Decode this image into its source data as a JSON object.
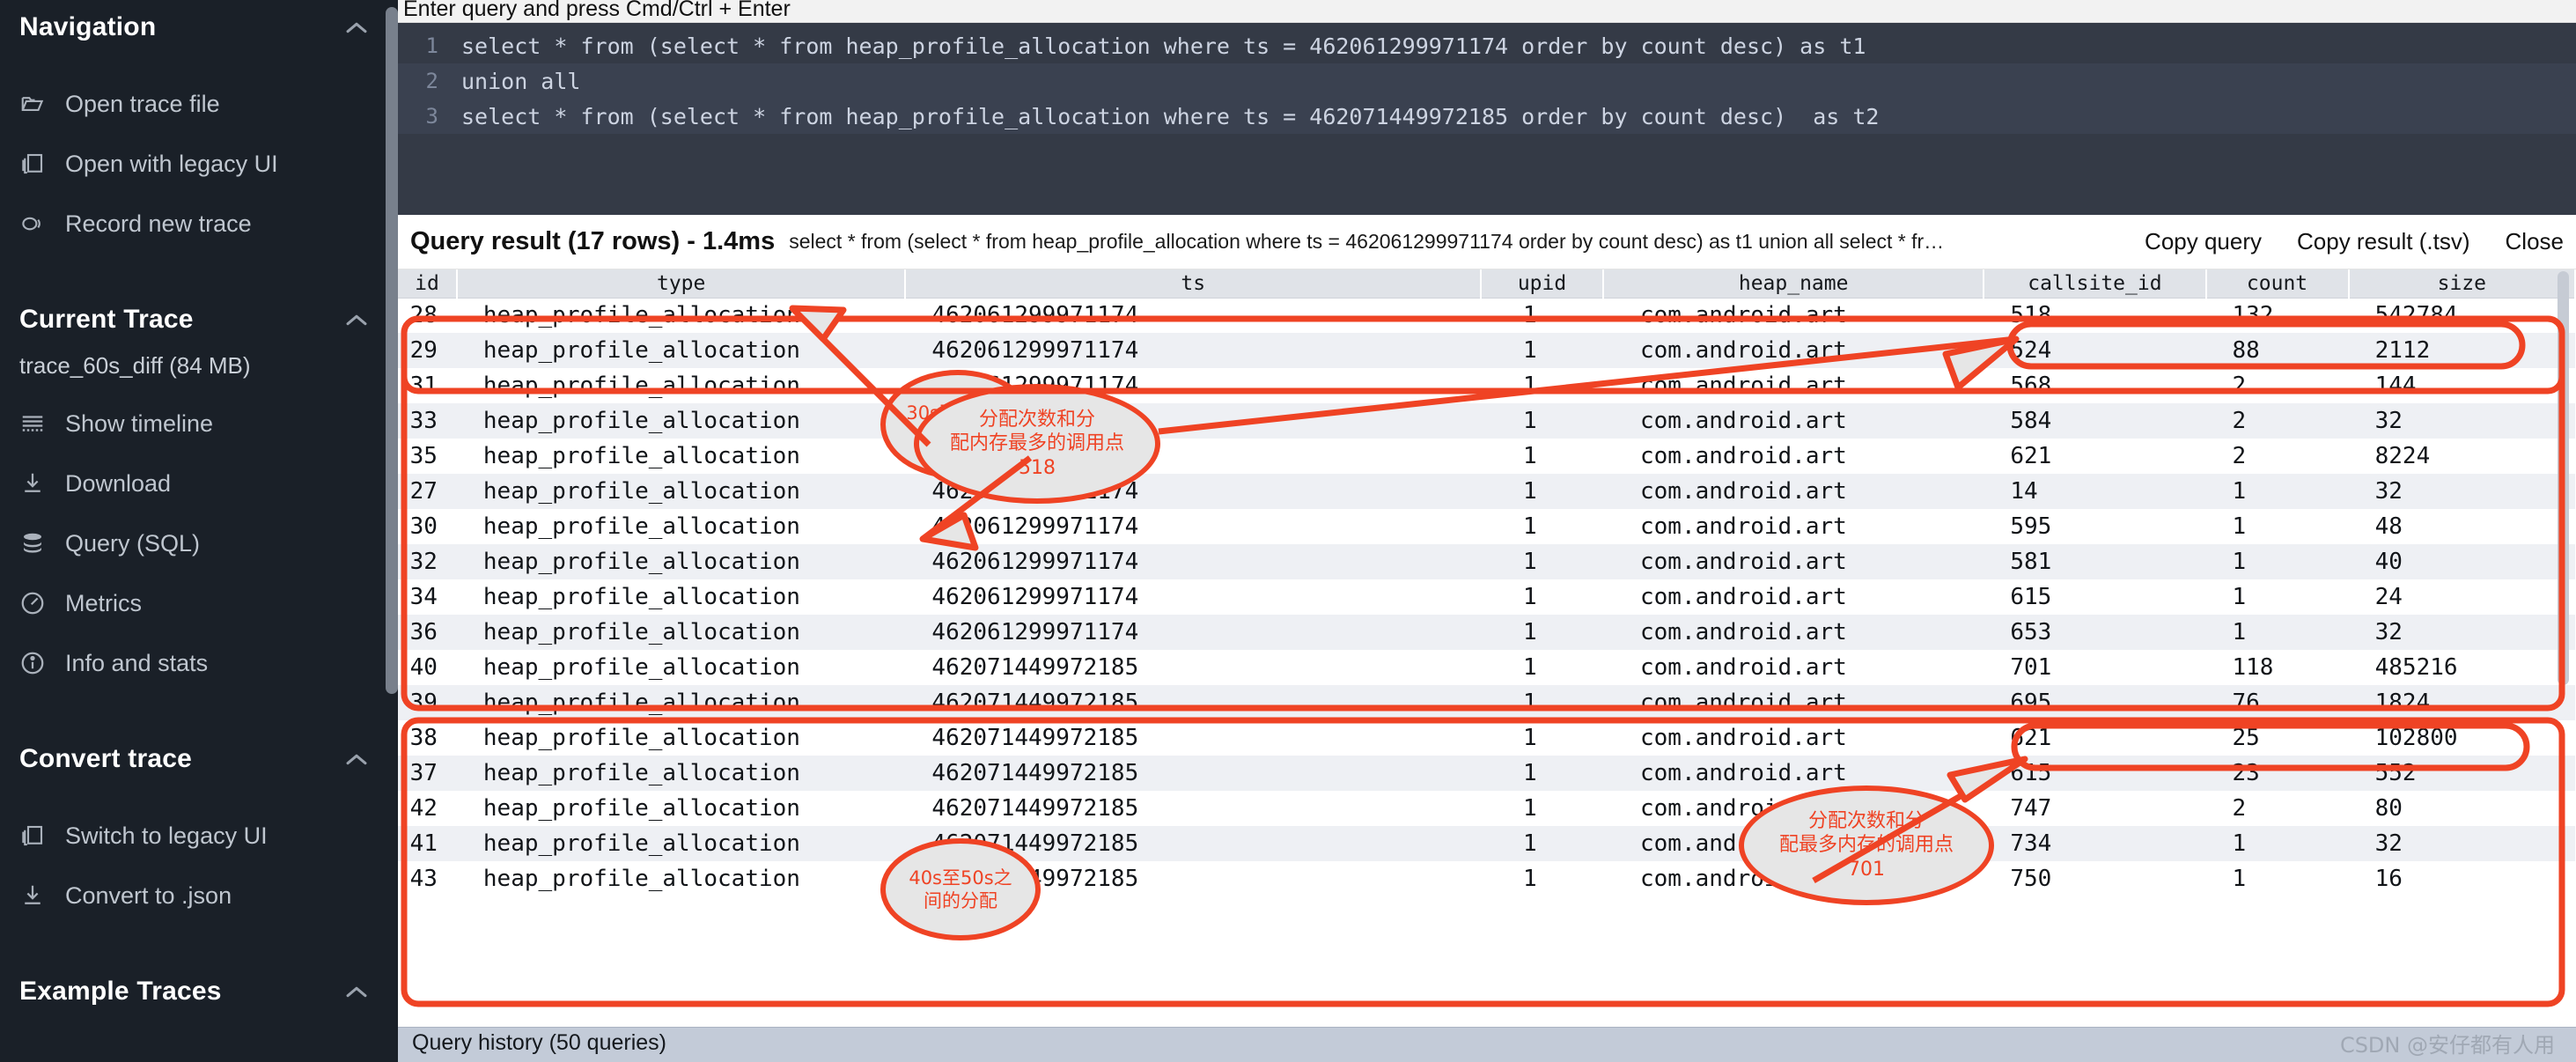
{
  "sidebar": {
    "sections": [
      {
        "title": "Navigation",
        "items": [
          {
            "label": "Open trace file",
            "icon": "folder-open-icon"
          },
          {
            "label": "Open with legacy UI",
            "icon": "window-copy-icon"
          },
          {
            "label": "Record new trace",
            "icon": "record-icon"
          }
        ]
      },
      {
        "title": "Current Trace",
        "trace_name": "trace_60s_diff (84 MB)",
        "items": [
          {
            "label": "Show timeline",
            "icon": "timeline-icon"
          },
          {
            "label": "Download",
            "icon": "download-icon"
          },
          {
            "label": "Query (SQL)",
            "icon": "database-icon"
          },
          {
            "label": "Metrics",
            "icon": "gauge-icon"
          },
          {
            "label": "Info and stats",
            "icon": "info-icon"
          }
        ]
      },
      {
        "title": "Convert trace",
        "items": [
          {
            "label": "Switch to legacy UI",
            "icon": "window-copy-icon"
          },
          {
            "label": "Convert to .json",
            "icon": "download-icon"
          }
        ]
      },
      {
        "title": "Example Traces",
        "items": []
      }
    ]
  },
  "omnibox": {
    "hint": "Enter query and press Cmd/Ctrl + Enter"
  },
  "editor": {
    "lines": [
      {
        "number": "1",
        "text": "select * from (select * from heap_profile_allocation where ts = 462061299971174 order by count desc) as t1"
      },
      {
        "number": "2",
        "text": "union all"
      },
      {
        "number": "3",
        "text": "select * from (select * from heap_profile_allocation where ts = 462071449972185 order by count desc)  as t2"
      }
    ]
  },
  "result_header": {
    "title": "Query result (17 rows) - 1.4ms",
    "query_summary": "select * from (select * from heap_profile_allocation where ts = 462061299971174 order by count desc) as t1 union all select * fr…",
    "copy_query_label": "Copy query",
    "copy_result_label": "Copy result (.tsv)",
    "close_label": "Close"
  },
  "table": {
    "columns": [
      "id",
      "type",
      "ts",
      "upid",
      "heap_name",
      "callsite_id",
      "count",
      "size"
    ],
    "rows": [
      {
        "id": "28",
        "type": "heap_profile_allocation",
        "ts": "462061299971174",
        "upid": "1",
        "heap_name": "com.android.art",
        "callsite_id": "518",
        "count": "132",
        "size": "542784"
      },
      {
        "id": "29",
        "type": "heap_profile_allocation",
        "ts": "462061299971174",
        "upid": "1",
        "heap_name": "com.android.art",
        "callsite_id": "524",
        "count": "88",
        "size": "2112"
      },
      {
        "id": "31",
        "type": "heap_profile_allocation",
        "ts": "462061299971174",
        "upid": "1",
        "heap_name": "com.android.art",
        "callsite_id": "568",
        "count": "2",
        "size": "144"
      },
      {
        "id": "33",
        "type": "heap_profile_allocation",
        "ts": "462061299971174",
        "upid": "1",
        "heap_name": "com.android.art",
        "callsite_id": "584",
        "count": "2",
        "size": "32"
      },
      {
        "id": "35",
        "type": "heap_profile_allocation",
        "ts": "462061299971174",
        "upid": "1",
        "heap_name": "com.android.art",
        "callsite_id": "621",
        "count": "2",
        "size": "8224"
      },
      {
        "id": "27",
        "type": "heap_profile_allocation",
        "ts": "462061299971174",
        "upid": "1",
        "heap_name": "com.android.art",
        "callsite_id": "14",
        "count": "1",
        "size": "32"
      },
      {
        "id": "30",
        "type": "heap_profile_allocation",
        "ts": "462061299971174",
        "upid": "1",
        "heap_name": "com.android.art",
        "callsite_id": "595",
        "count": "1",
        "size": "48"
      },
      {
        "id": "32",
        "type": "heap_profile_allocation",
        "ts": "462061299971174",
        "upid": "1",
        "heap_name": "com.android.art",
        "callsite_id": "581",
        "count": "1",
        "size": "40"
      },
      {
        "id": "34",
        "type": "heap_profile_allocation",
        "ts": "462061299971174",
        "upid": "1",
        "heap_name": "com.android.art",
        "callsite_id": "615",
        "count": "1",
        "size": "24"
      },
      {
        "id": "36",
        "type": "heap_profile_allocation",
        "ts": "462061299971174",
        "upid": "1",
        "heap_name": "com.android.art",
        "callsite_id": "653",
        "count": "1",
        "size": "32"
      },
      {
        "id": "40",
        "type": "heap_profile_allocation",
        "ts": "462071449972185",
        "upid": "1",
        "heap_name": "com.android.art",
        "callsite_id": "701",
        "count": "118",
        "size": "485216"
      },
      {
        "id": "39",
        "type": "heap_profile_allocation",
        "ts": "462071449972185",
        "upid": "1",
        "heap_name": "com.android.art",
        "callsite_id": "695",
        "count": "76",
        "size": "1824"
      },
      {
        "id": "38",
        "type": "heap_profile_allocation",
        "ts": "462071449972185",
        "upid": "1",
        "heap_name": "com.android.art",
        "callsite_id": "621",
        "count": "25",
        "size": "102800"
      },
      {
        "id": "37",
        "type": "heap_profile_allocation",
        "ts": "462071449972185",
        "upid": "1",
        "heap_name": "com.android.art",
        "callsite_id": "615",
        "count": "23",
        "size": "552"
      },
      {
        "id": "42",
        "type": "heap_profile_allocation",
        "ts": "462071449972185",
        "upid": "1",
        "heap_name": "com.android.art",
        "callsite_id": "747",
        "count": "2",
        "size": "80"
      },
      {
        "id": "41",
        "type": "heap_profile_allocation",
        "ts": "462071449972185",
        "upid": "1",
        "heap_name": "com.android.art",
        "callsite_id": "734",
        "count": "1",
        "size": "32"
      },
      {
        "id": "43",
        "type": "heap_profile_allocation",
        "ts": "462071449972185",
        "upid": "1",
        "heap_name": "com.android.art",
        "callsite_id": "750",
        "count": "1",
        "size": "16"
      }
    ]
  },
  "status_bar": {
    "query_history": "Query history (50 queries)"
  },
  "watermark": "CSDN @安仔都有人用",
  "annotations": {
    "accent_color": "#ef4324",
    "callout_1": "30s至40s之\n间的分配",
    "callout_2": "分配次数和分\n配内存最多的调用点\n518",
    "callout_3": "40s至50s之\n间的分配",
    "callout_4": "分配次数和分\n配最多内存的调用点\n701"
  }
}
